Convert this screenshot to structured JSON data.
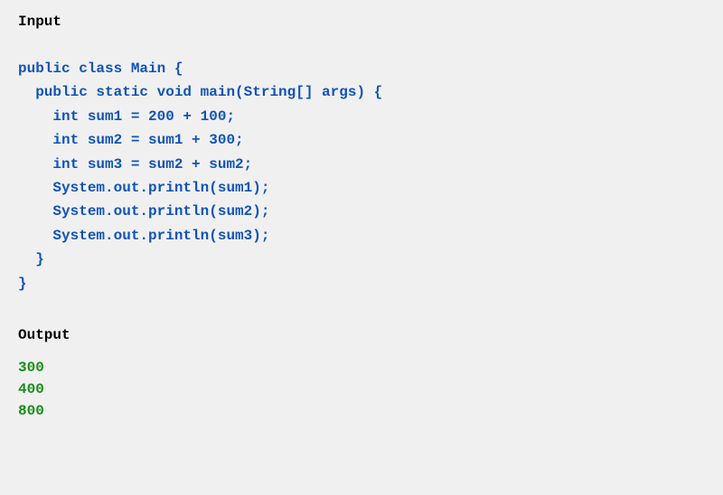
{
  "input": {
    "title": "Input",
    "code": {
      "line1": "",
      "line2": "public class Main {",
      "line3": "  public static void main(String[] args) {",
      "line4": "    int sum1 = 200 + 100;",
      "line5": "    int sum2 = sum1 + 300;",
      "line6": "    int sum3 = sum2 + sum2;",
      "line7": "    System.out.println(sum1);",
      "line8": "    System.out.println(sum2);",
      "line9": "    System.out.println(sum3);",
      "line10": "  }",
      "line11": "}"
    }
  },
  "output": {
    "title": "Output",
    "lines": {
      "l1": "300",
      "l2": "400",
      "l3": "800"
    }
  }
}
